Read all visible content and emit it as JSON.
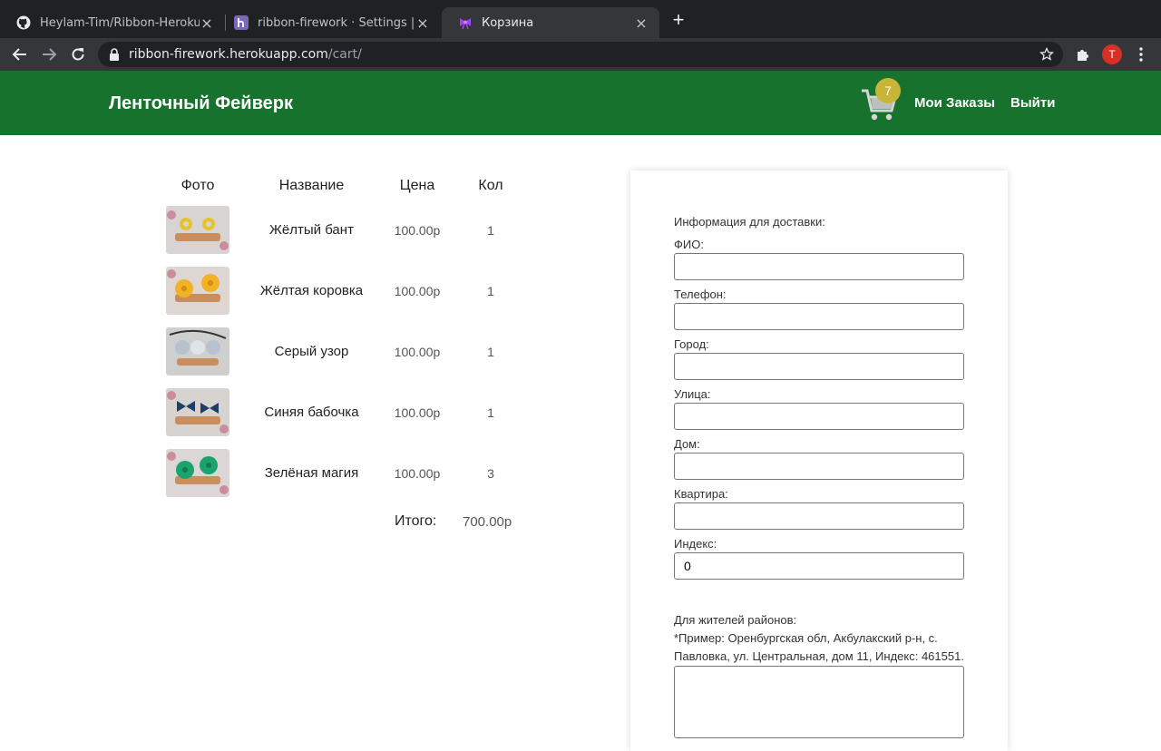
{
  "browser": {
    "tabs": [
      {
        "title": "Heylam-Tim/Ribbon-Heroku",
        "icon": "github-icon"
      },
      {
        "title": "ribbon-firework · Settings | Her",
        "icon": "heroku-icon"
      },
      {
        "title": "Корзина",
        "icon": "ribbon-icon"
      }
    ],
    "url_host": "ribbon-firework.herokuapp.com",
    "url_path": "/cart/",
    "avatar_letter": "T"
  },
  "header": {
    "brand": "Ленточный Фейверк",
    "cart_count": "7",
    "links": [
      "Мои Заказы",
      "Выйти"
    ],
    "bg_color": "#17722e",
    "badge_color": "#c8b537"
  },
  "cart": {
    "columns": [
      "Фото",
      "Название",
      "Цена",
      "Кол"
    ],
    "items": [
      {
        "name": "Жёлтый бант",
        "price": "100.00р",
        "qty": "1",
        "color": "#e5c42a"
      },
      {
        "name": "Жёлтая коровка",
        "price": "100.00р",
        "qty": "1",
        "color": "#f0b323"
      },
      {
        "name": "Серый узор",
        "price": "100.00р",
        "qty": "1",
        "color": "#b8c2cf"
      },
      {
        "name": "Синяя бабочка",
        "price": "100.00р",
        "qty": "1",
        "color": "#1f3e66"
      },
      {
        "name": "Зелёная магия",
        "price": "100.00р",
        "qty": "3",
        "color": "#1aa36c"
      }
    ],
    "total_label": "Итого:",
    "total_value": "700.00р"
  },
  "form": {
    "title": "Информация для доставки:",
    "fields": [
      {
        "label": "ФИО:",
        "value": ""
      },
      {
        "label": "Телефон:",
        "value": ""
      },
      {
        "label": "Город:",
        "value": ""
      },
      {
        "label": "Улица:",
        "value": ""
      },
      {
        "label": "Дом:",
        "value": ""
      },
      {
        "label": "Квартира:",
        "value": ""
      },
      {
        "label": "Индекс:",
        "value": "0"
      }
    ],
    "note_title": "Для жителей районов:",
    "note_text": "*Пример: Оренбургская обл, Акбулакский р-н, с. Павловка, ул. Центральная, дом 11, Индекс: 461551."
  }
}
